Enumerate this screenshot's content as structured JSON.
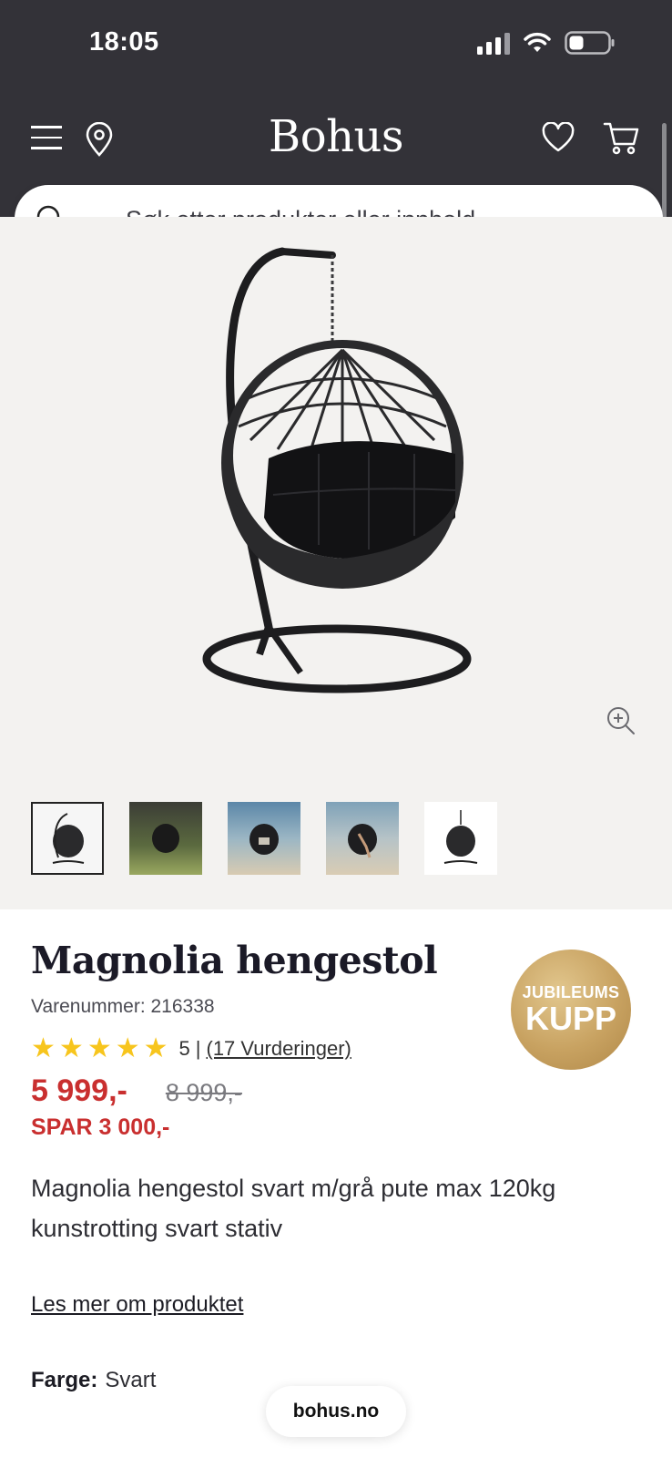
{
  "status_bar": {
    "time": "18:05"
  },
  "header": {
    "logo": "Bohus",
    "icons": [
      "menu-icon",
      "location-pin-icon",
      "heart-icon",
      "cart-icon"
    ]
  },
  "search": {
    "placeholder": "Søk etter produkter eller innhold ..."
  },
  "gallery": {
    "thumbnails": [
      "thumbnail-1",
      "thumbnail-2",
      "thumbnail-3",
      "thumbnail-4",
      "thumbnail-5"
    ],
    "active_thumbnail": 1
  },
  "product": {
    "title": "Magnolia hengestol",
    "sku": "Varenummer: 216338",
    "badge": {
      "line1": "JUBILEUMS",
      "line2": "KUPP"
    },
    "rating": {
      "stars": 5,
      "value": "5",
      "separator": "|",
      "reviews_label": "(17 Vurderinger)"
    },
    "price_now": "5 999,-",
    "price_old": "8 999,-",
    "saving": "SPAR 3 000,-",
    "description": "Magnolia hengestol svart m/grå pute max 120kg kunstrotting svart stativ",
    "read_more": "Les mer om produktet",
    "color_label": "Farge:",
    "color_value": "Svart"
  },
  "browser": {
    "url": "bohus.no"
  },
  "colors": {
    "header_bg": "#333238",
    "price_red": "#c92f2f",
    "star_yellow": "#f7c51d",
    "badge_gold": "#c8a261",
    "gallery_bg": "#f3f2f0"
  }
}
